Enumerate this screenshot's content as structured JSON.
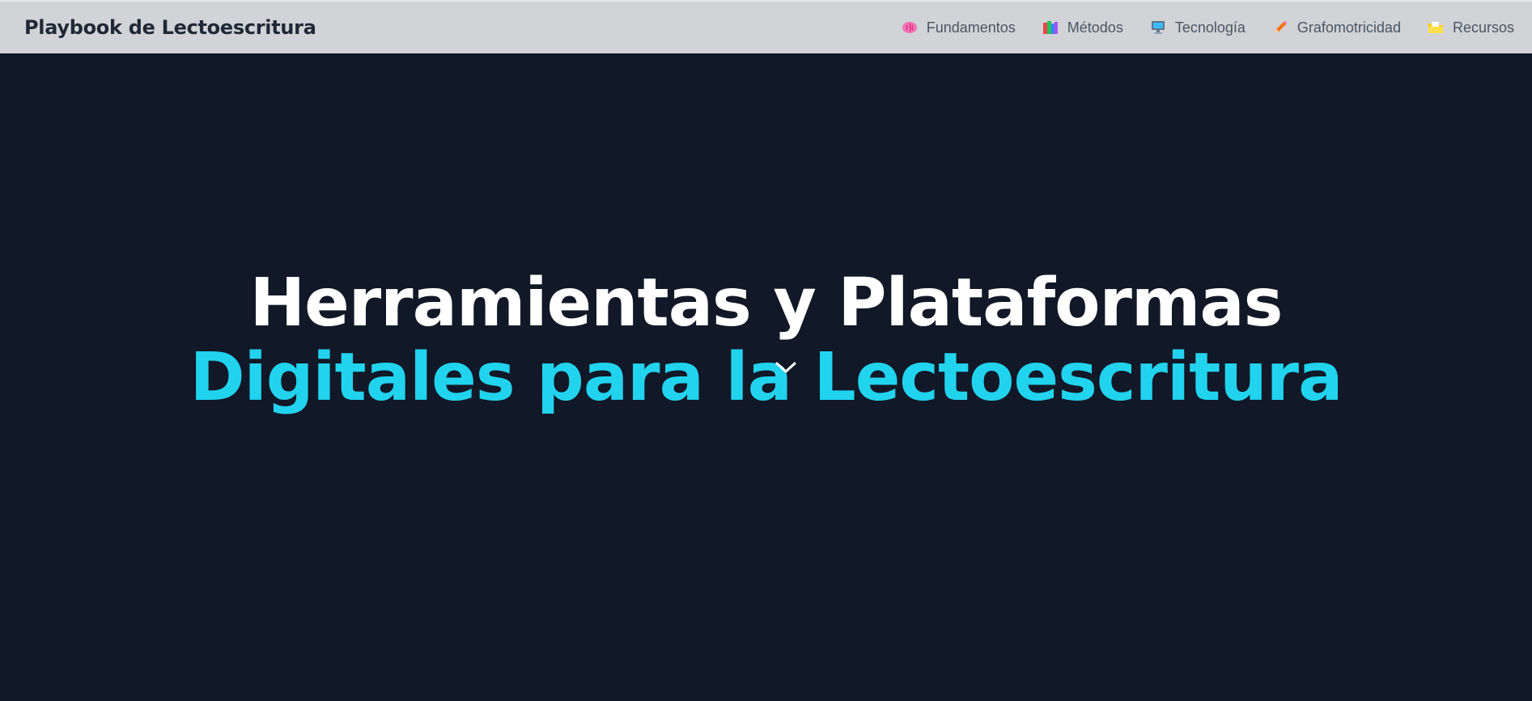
{
  "header": {
    "brand": "Playbook de Lectoescritura"
  },
  "nav": {
    "items": [
      {
        "label": "Fundamentos",
        "icon": "brain-icon"
      },
      {
        "label": "Métodos",
        "icon": "books-icon"
      },
      {
        "label": "Tecnología",
        "icon": "computer-icon"
      },
      {
        "label": "Grafomotricidad",
        "icon": "pencil-icon"
      },
      {
        "label": "Recursos",
        "icon": "folder-icon"
      }
    ]
  },
  "hero": {
    "title_line1": "Herramientas y Plataformas",
    "title_line2": "Digitales para la Lectoescritura"
  },
  "colors": {
    "background": "#111827",
    "header_bg": "#d1d3d6",
    "accent": "#22d3ee",
    "title_white": "#ffffff"
  }
}
